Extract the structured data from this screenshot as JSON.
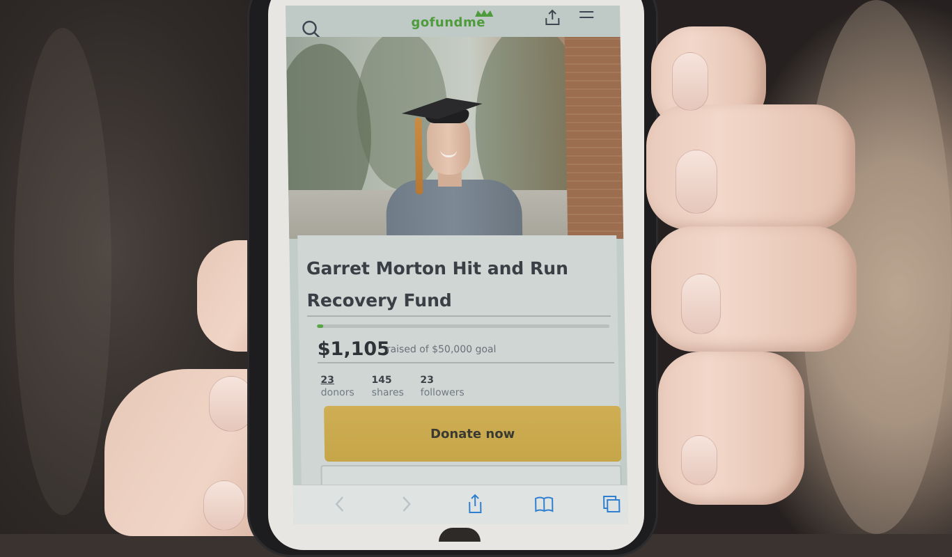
{
  "header": {
    "logo_text": "gofundme",
    "icons": [
      "search-icon",
      "share-icon",
      "menu-icon"
    ]
  },
  "campaign": {
    "title": "Garret Morton Hit and Run Recovery Fund",
    "amount_raised": "$1,105",
    "goal_text": "raised of $50,000 goal",
    "progress_fraction": 0.022,
    "stats": [
      {
        "value": "23",
        "label": "donors"
      },
      {
        "value": "145",
        "label": "shares"
      },
      {
        "value": "23",
        "label": "followers"
      }
    ],
    "donate_label": "Donate now"
  },
  "browser_toolbar": {
    "icons": [
      "back-icon",
      "forward-icon",
      "share-icon",
      "bookmarks-icon",
      "tabs-icon"
    ]
  },
  "colors": {
    "brand_green": "#5aa545",
    "donate_button": "#c9aa4e",
    "title_text": "#3a3f45"
  }
}
